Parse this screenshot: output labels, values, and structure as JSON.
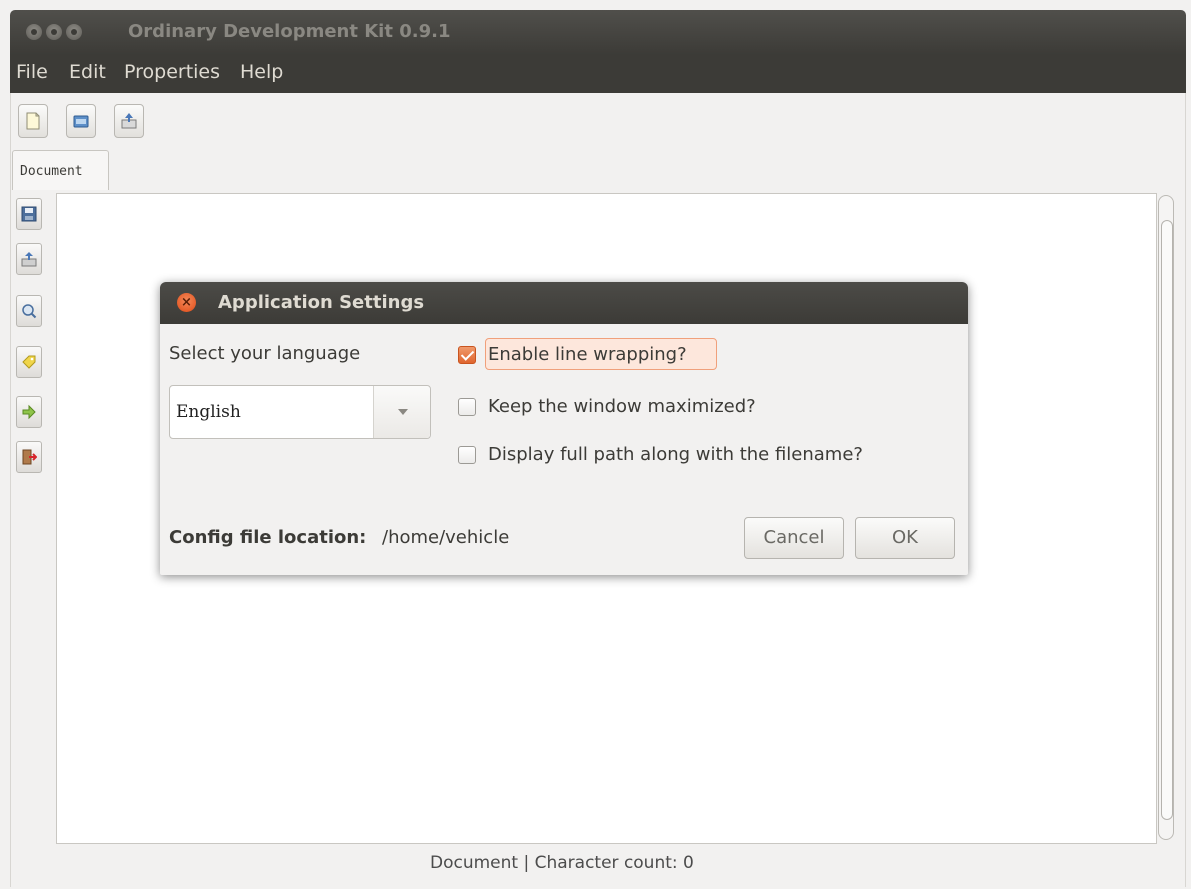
{
  "window": {
    "title": "Ordinary Development Kit 0.9.1"
  },
  "menubar": {
    "items": [
      "File",
      "Edit",
      "Properties",
      "Help"
    ]
  },
  "toolbar": {
    "buttons": [
      "new-file-icon",
      "open-folder-icon",
      "import-icon"
    ]
  },
  "tabs": [
    {
      "label": "Document"
    }
  ],
  "sidebar": {
    "buttons": [
      "save-icon",
      "export-icon",
      "search-icon",
      "tag-icon",
      "forward-icon",
      "exit-icon"
    ]
  },
  "status": {
    "text": "Document  | Character count: 0"
  },
  "dialog": {
    "title": "Application Settings",
    "language_label": "Select your language",
    "language_value": "English",
    "options": [
      {
        "label": "Enable line wrapping?",
        "checked": true
      },
      {
        "label": "Keep the window maximized?",
        "checked": false
      },
      {
        "label": "Display full path along with the filename?",
        "checked": false
      }
    ],
    "config_label": "Config file location:",
    "config_value": "/home/vehicle",
    "cancel_label": "Cancel",
    "ok_label": "OK"
  },
  "colors": {
    "titlebar": "#3c3b37",
    "accent": "#e0652e"
  }
}
